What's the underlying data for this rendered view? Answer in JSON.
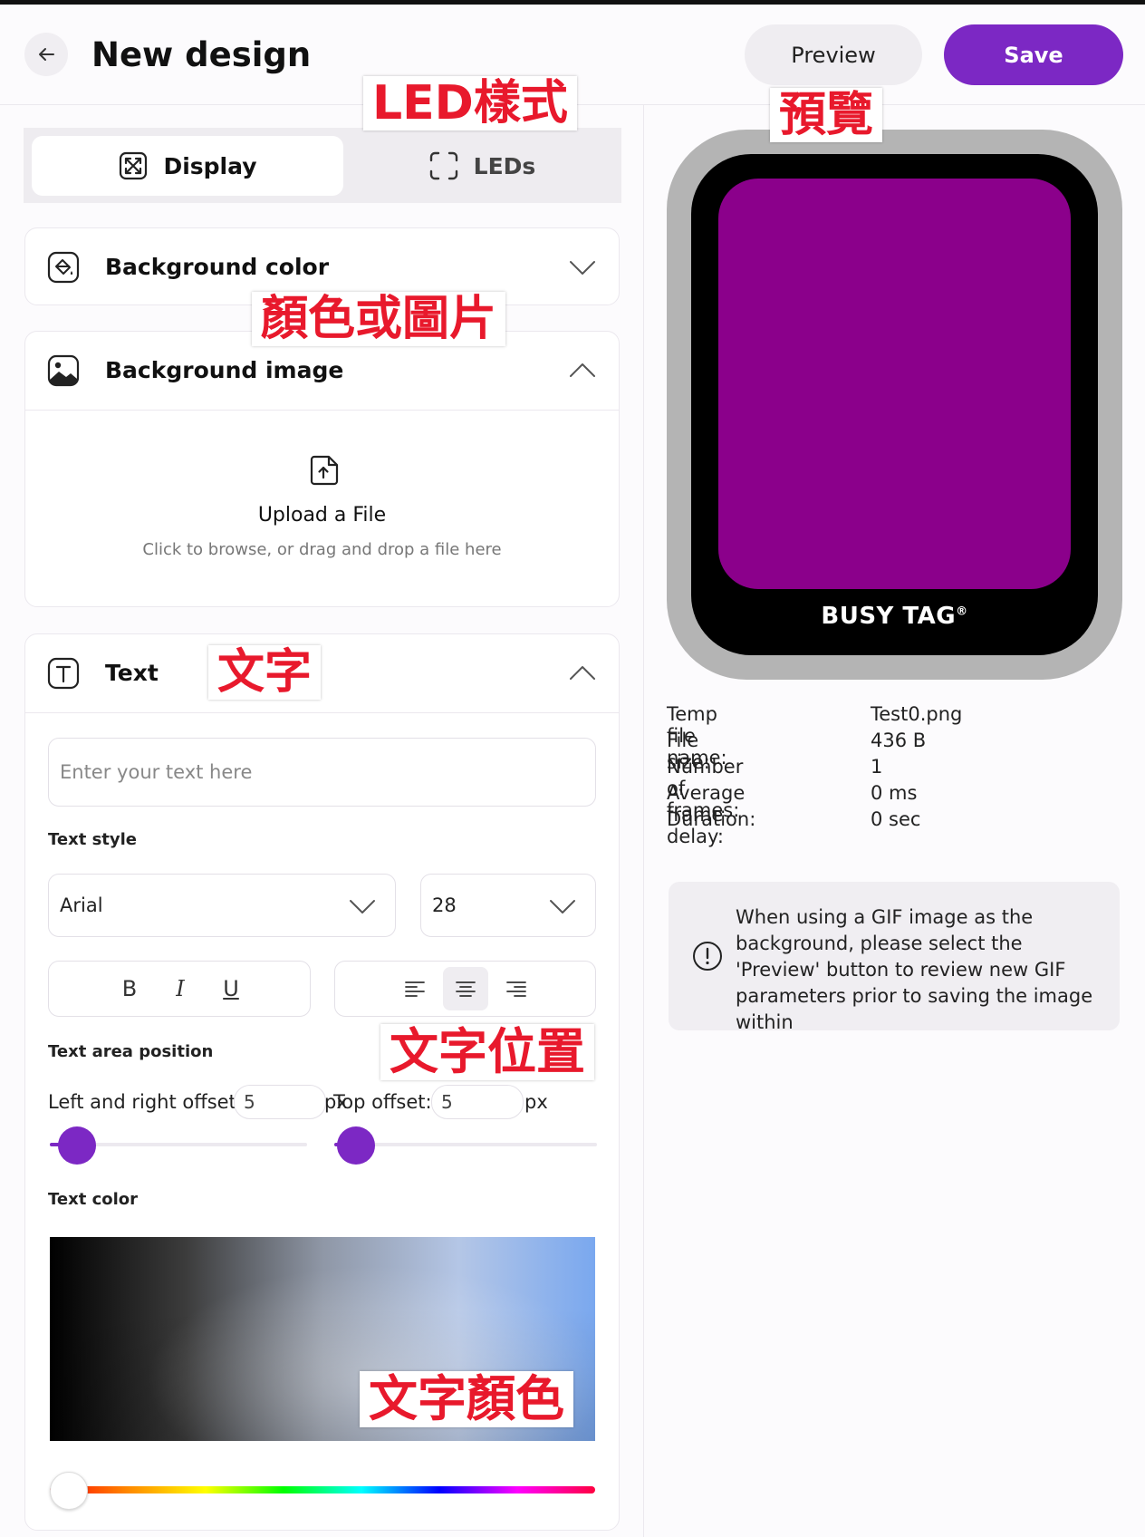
{
  "header": {
    "title": "New design",
    "preview_label": "Preview",
    "save_label": "Save"
  },
  "tabs": [
    {
      "label": "Display",
      "icon": "display-icon",
      "active": true
    },
    {
      "label": "LEDs",
      "icon": "leds-icon",
      "active": false
    }
  ],
  "sections": {
    "background_color": {
      "label": "Background color",
      "expanded": false
    },
    "background_image": {
      "label": "Background image",
      "expanded": true,
      "upload_title": "Upload a File",
      "upload_subtitle": "Click to browse, or drag and drop a file here"
    },
    "text": {
      "label": "Text",
      "expanded": true,
      "input_placeholder": "Enter your text here",
      "input_value": "",
      "style_label": "Text style",
      "font": "Arial",
      "font_size": "28",
      "format_buttons": [
        "B",
        "I",
        "U"
      ],
      "alignment": "center",
      "position_label": "Text area position",
      "lr_offset_label": "Left and right offset:",
      "lr_offset_value": "5",
      "top_offset_label": "Top offset:",
      "top_offset_value": "5",
      "unit": "px",
      "color_label": "Text color"
    }
  },
  "preview": {
    "brand": "BUSY TAG",
    "brand_mark": "®",
    "screen_color": "#8b008b",
    "info": [
      {
        "key": "Temp file name:",
        "value": "Test0.png"
      },
      {
        "key": "File size:",
        "value": "436 B"
      },
      {
        "key": "Number of frames:",
        "value": "1"
      },
      {
        "key": "Average frame delay:",
        "value": "0 ms"
      },
      {
        "key": "Duration:",
        "value": "0 sec"
      }
    ],
    "notice": "When using a GIF image as the background, please select the 'Preview' button to review new GIF parameters prior to saving the image within"
  },
  "annotations": {
    "led_style": "LED樣式",
    "preview": "預覽",
    "color_or_image": "顏色或圖片",
    "text": "文字",
    "text_position": "文字位置",
    "text_color": "文字顏色"
  },
  "colors": {
    "accent": "#7c28c4",
    "annotation_red": "#e8192c"
  }
}
